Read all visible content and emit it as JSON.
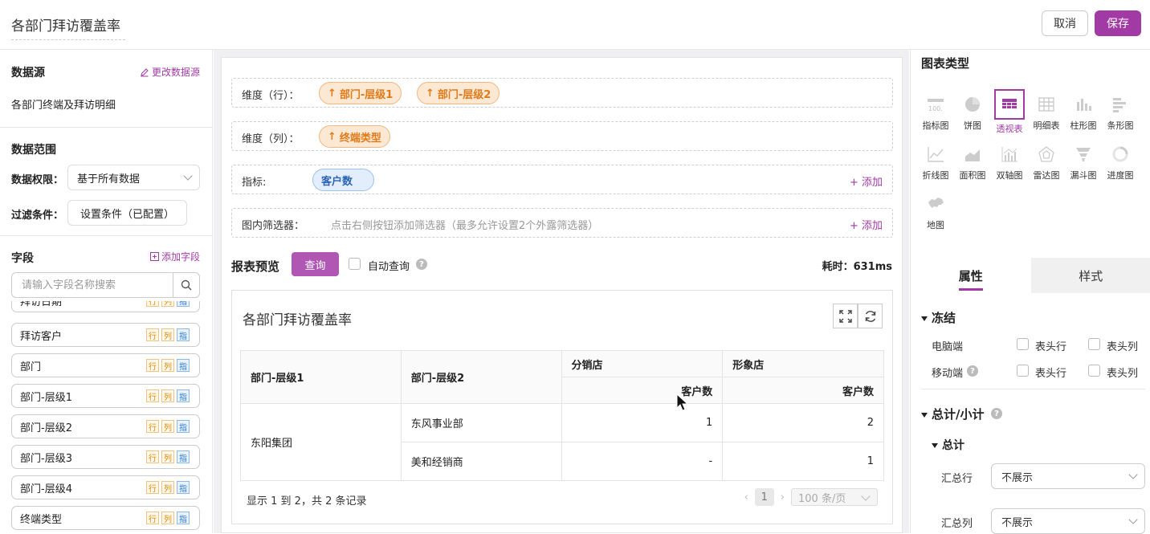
{
  "header": {
    "title": "各部门拜访覆盖率",
    "cancel": "取消",
    "save": "保存"
  },
  "left": {
    "datasource_heading": "数据源",
    "change_source": "更改数据源",
    "datasource_name": "各部门终端及拜访明细",
    "range_heading": "数据范围",
    "permission_label": "数据权限：",
    "permission_value": "基于所有数据",
    "filter_label": "过滤条件：",
    "filter_value": "设置条件（已配置）",
    "fields_heading": "字段",
    "add_field": "添加字段",
    "search_placeholder": "请输入字段名称搜索",
    "partial_field": "拜访日期",
    "fields": [
      "拜访客户",
      "部门",
      "部门-层级1",
      "部门-层级2",
      "部门-层级3",
      "部门-层级4",
      "终端类型"
    ],
    "tag_row": "行",
    "tag_col": "列",
    "tag_metric": "指"
  },
  "builder": {
    "rows_label": "维度（行）：",
    "rows": [
      "部门-层级1",
      "部门-层级2"
    ],
    "cols_label": "维度（列）：",
    "cols": [
      "终端类型"
    ],
    "metric_label": "指标:",
    "metrics": [
      "客户数"
    ],
    "add": "+ 添加",
    "filter_label": "图内筛选器：",
    "filter_hint": "点击右侧按钮添加筛选器（最多允许设置2个外露筛选器）",
    "arrow": "↑"
  },
  "preview": {
    "title": "报表预览",
    "query": "查询",
    "auto_query": "自动查询",
    "elapsed": "耗时：631ms",
    "help": "?"
  },
  "report": {
    "title": "各部门拜访覆盖率",
    "h_level1": "部门-层级1",
    "h_level2": "部门-层级2",
    "col1": "分销店",
    "col2": "形象店",
    "metric": "客户数",
    "group": "东阳集团",
    "rows": [
      {
        "dept": "东风事业部",
        "v1": "1",
        "v2": "2"
      },
      {
        "dept": "美和经销商",
        "v1": "-",
        "v2": "1"
      }
    ],
    "summary": "显示 1 到 2，共 2 条记录",
    "page": "1",
    "page_size": "100 条/页"
  },
  "right": {
    "chart_type_heading": "图表类型",
    "chart_types": [
      "指标图",
      "饼图",
      "透视表",
      "明细表",
      "柱形图",
      "条形图",
      "折线图",
      "面积图",
      "双轴图",
      "雷达图",
      "漏斗图",
      "进度图",
      "地图"
    ],
    "selected_chart_type": "透视表",
    "tab_props": "属性",
    "tab_style": "样式",
    "freeze": "冻结",
    "pc": "电脑端",
    "mobile": "移动端",
    "head_row": "表头行",
    "head_col": "表头列",
    "totals": "总计/小计",
    "total": "总计",
    "sum_row": "汇总行",
    "sum_col": "汇总列",
    "no_show": "不展示"
  },
  "colors": {
    "accent": "#a23aa6",
    "pill_orange": "#e07a1a",
    "pill_blue": "#2a63b4"
  }
}
